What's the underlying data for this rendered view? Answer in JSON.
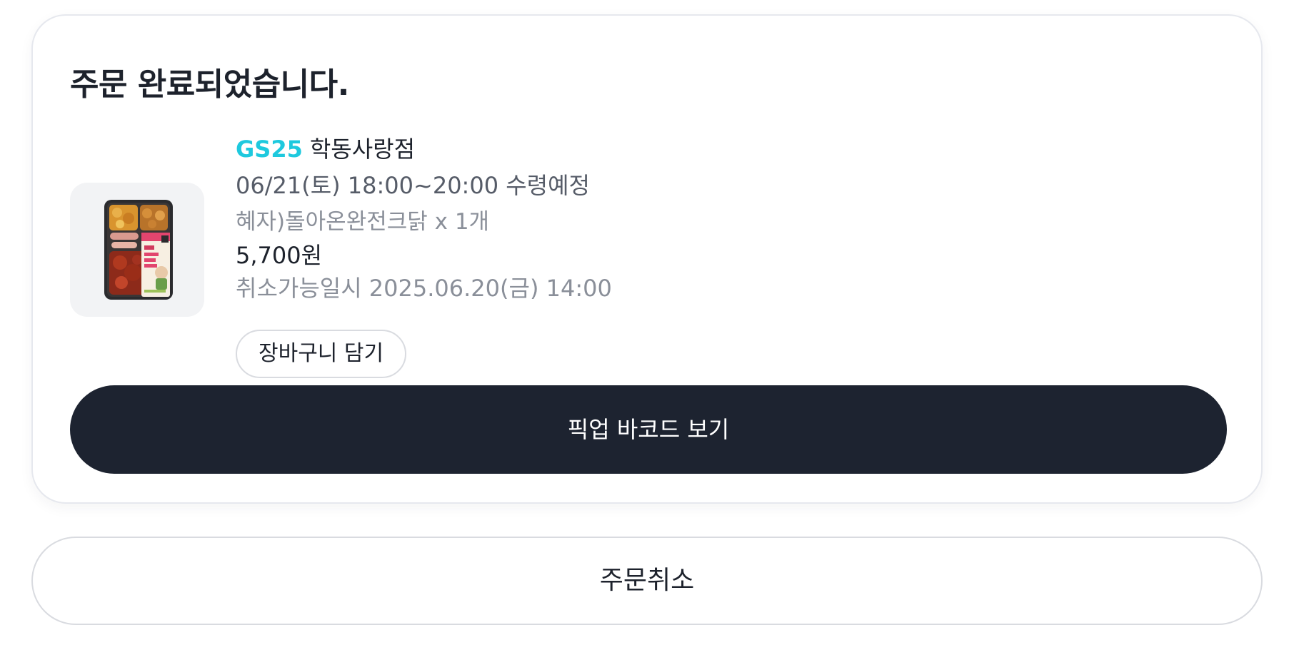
{
  "order_card": {
    "title": "주문 완료되었습니다.",
    "store": {
      "brand": "GS25",
      "name": "학동사랑점"
    },
    "pickup_schedule": "06/21(토) 18:00~20:00 수령예정",
    "product": "혜자)돌아온완전크닭 x 1개",
    "price": "5,700원",
    "cancel_deadline": "취소가능일시 2025.06.20(금) 14:00",
    "add_to_cart_label": "장바구니 담기",
    "barcode_button_label": "픽업 바코드 보기",
    "product_image_icon": "lunchbox-product-image"
  },
  "cancel_order_label": "주문취소",
  "colors": {
    "brand_accent": "#1ec9de",
    "primary_button": "#1d2330",
    "text_primary": "#1d222c",
    "text_secondary": "#565c68",
    "text_muted": "#8a8f99"
  }
}
